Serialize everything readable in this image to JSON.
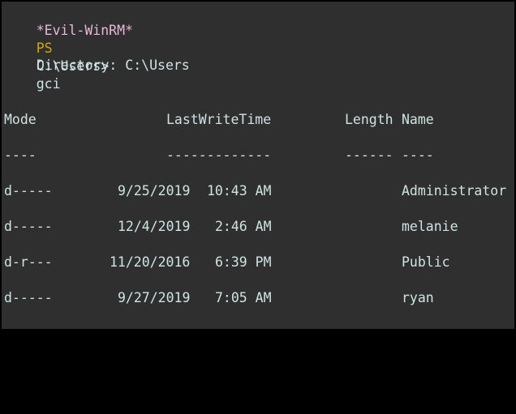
{
  "prompt": {
    "shell": "*Evil-WinRM*",
    "ps": "PS",
    "path": "C:\\Users>",
    "command": "gci"
  },
  "directory_label": "Directory: C:\\Users",
  "table": {
    "headers": [
      "Mode",
      "LastWriteTime",
      "Length",
      "Name"
    ],
    "separators": [
      "----",
      "-------------",
      "------",
      "----"
    ],
    "rows": [
      {
        "mode": "d-----",
        "date": "9/25/2019",
        "time": "10:43 AM",
        "length": "",
        "name": "Administrator"
      },
      {
        "mode": "d-----",
        "date": "12/4/2019",
        "time": "2:46 AM",
        "length": "",
        "name": "melanie"
      },
      {
        "mode": "d-r---",
        "date": "11/20/2016",
        "time": "6:39 PM",
        "length": "",
        "name": "Public"
      },
      {
        "mode": "d-----",
        "date": "9/27/2019",
        "time": "7:05 AM",
        "length": "",
        "name": "ryan"
      }
    ]
  },
  "colors": {
    "background": "#2f2f2f",
    "text": "#cfe3e3",
    "shell_prompt": "#e7b7d9",
    "ps_prompt": "#d7a800"
  }
}
